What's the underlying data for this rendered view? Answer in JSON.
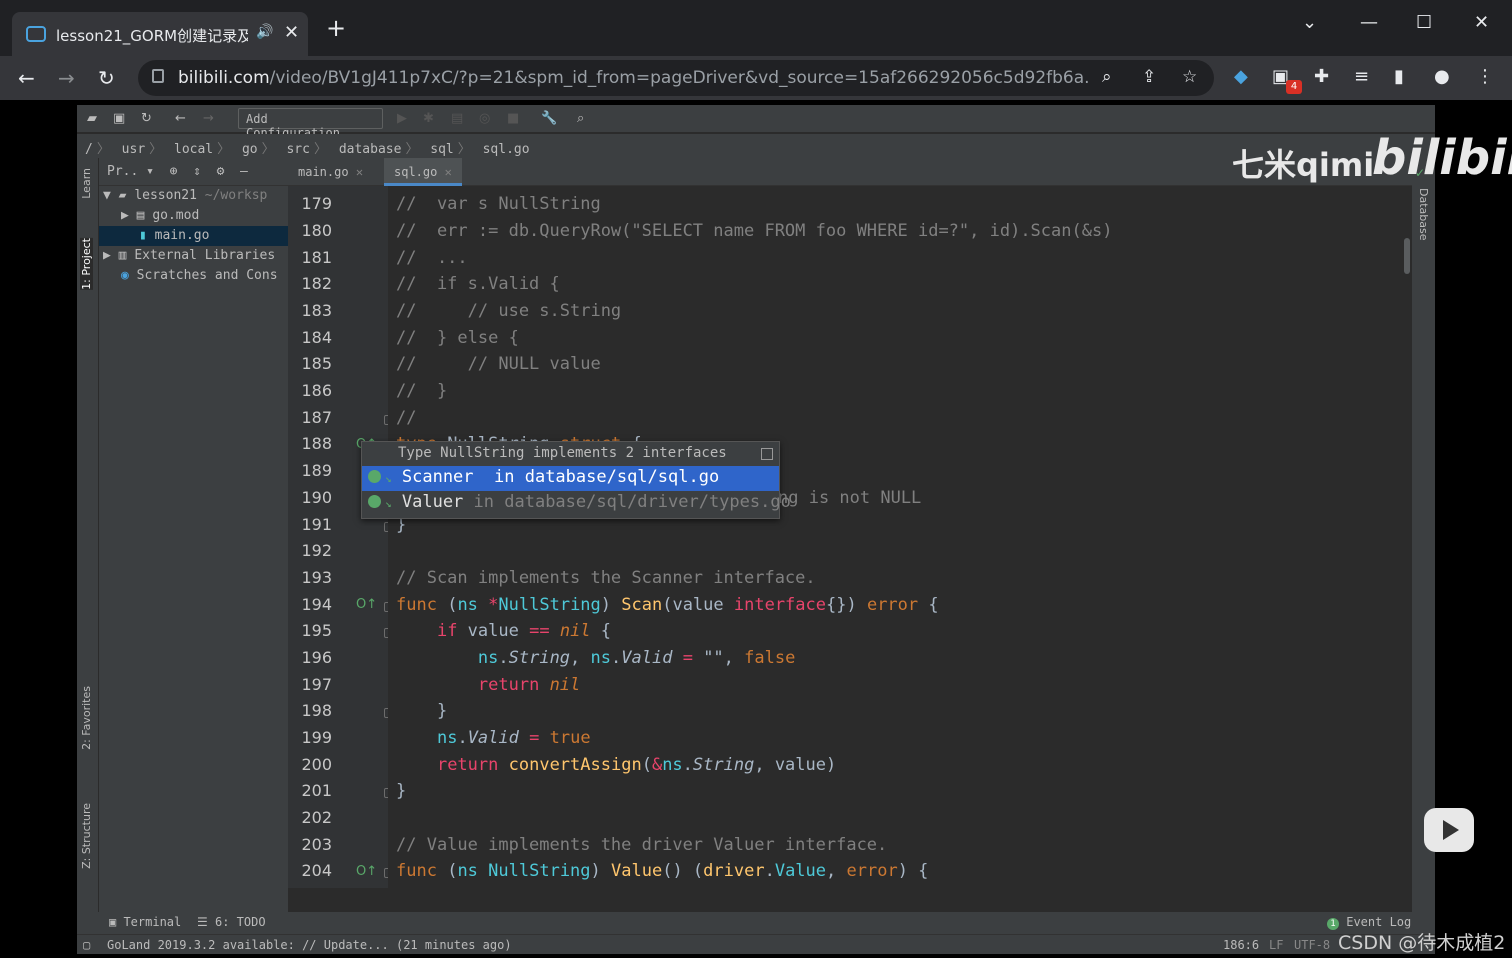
{
  "browser": {
    "tab_title": "lesson21_GORM创建记录及",
    "url_host": "bilibili.com",
    "url_path": "/video/BV1gJ411p7xC/?p=21&spm_id_from=pageDriver&vd_source=15af266292056c5d92fb6a...",
    "ext_badge": "4",
    "new_tab": "+",
    "sound_icon": "speaker-icon",
    "close_icon": "close-icon"
  },
  "ide": {
    "add_config": "Add Configuration...",
    "breadcrumbs": [
      "/",
      "usr",
      "local",
      "go",
      "src",
      "database",
      "sql",
      "sql.go"
    ],
    "left_strip": [
      "1: Project",
      "Learn",
      "2: Favorites",
      "Z: Structure"
    ],
    "right_strip": "Database",
    "project_header": "Pr..",
    "tree": [
      {
        "label": "lesson21",
        "extra": "~/worksp"
      },
      {
        "label": "go.mod",
        "extra": ""
      },
      {
        "label": "main.go",
        "extra": ""
      },
      {
        "label": "External Libraries",
        "extra": ""
      },
      {
        "label": "Scratches and Cons",
        "extra": ""
      }
    ],
    "tabs": [
      "main.go",
      "sql.go"
    ],
    "line_numbers": [
      "179",
      "180",
      "181",
      "182",
      "183",
      "184",
      "185",
      "186",
      "187",
      "188",
      "189",
      "190",
      "191",
      "192",
      "193",
      "194",
      "195",
      "196",
      "197",
      "198",
      "199",
      "200",
      "201",
      "202",
      "203",
      "204"
    ],
    "popup": {
      "header": "Type NullString implements 2 interfaces",
      "items": [
        {
          "name": "Scanner",
          "loc": "in database/sql/sql.go"
        },
        {
          "name": "Valuer",
          "loc": "in database/sql/driver/types.go"
        }
      ]
    },
    "bottom_tools": {
      "terminal": "Terminal",
      "todo": "6: TODO",
      "event_log": "Event Log",
      "event_count": "1"
    },
    "status": {
      "message": "GoLand 2019.3.2 available: // Update... (21 minutes ago)",
      "position": "186:6",
      "lf": "LF",
      "encoding": "UTF-8"
    }
  },
  "overlay": {
    "wm_text": "七米qimi",
    "wm_logo": "bilibili",
    "csdn": "CSDN @待木成植2"
  }
}
